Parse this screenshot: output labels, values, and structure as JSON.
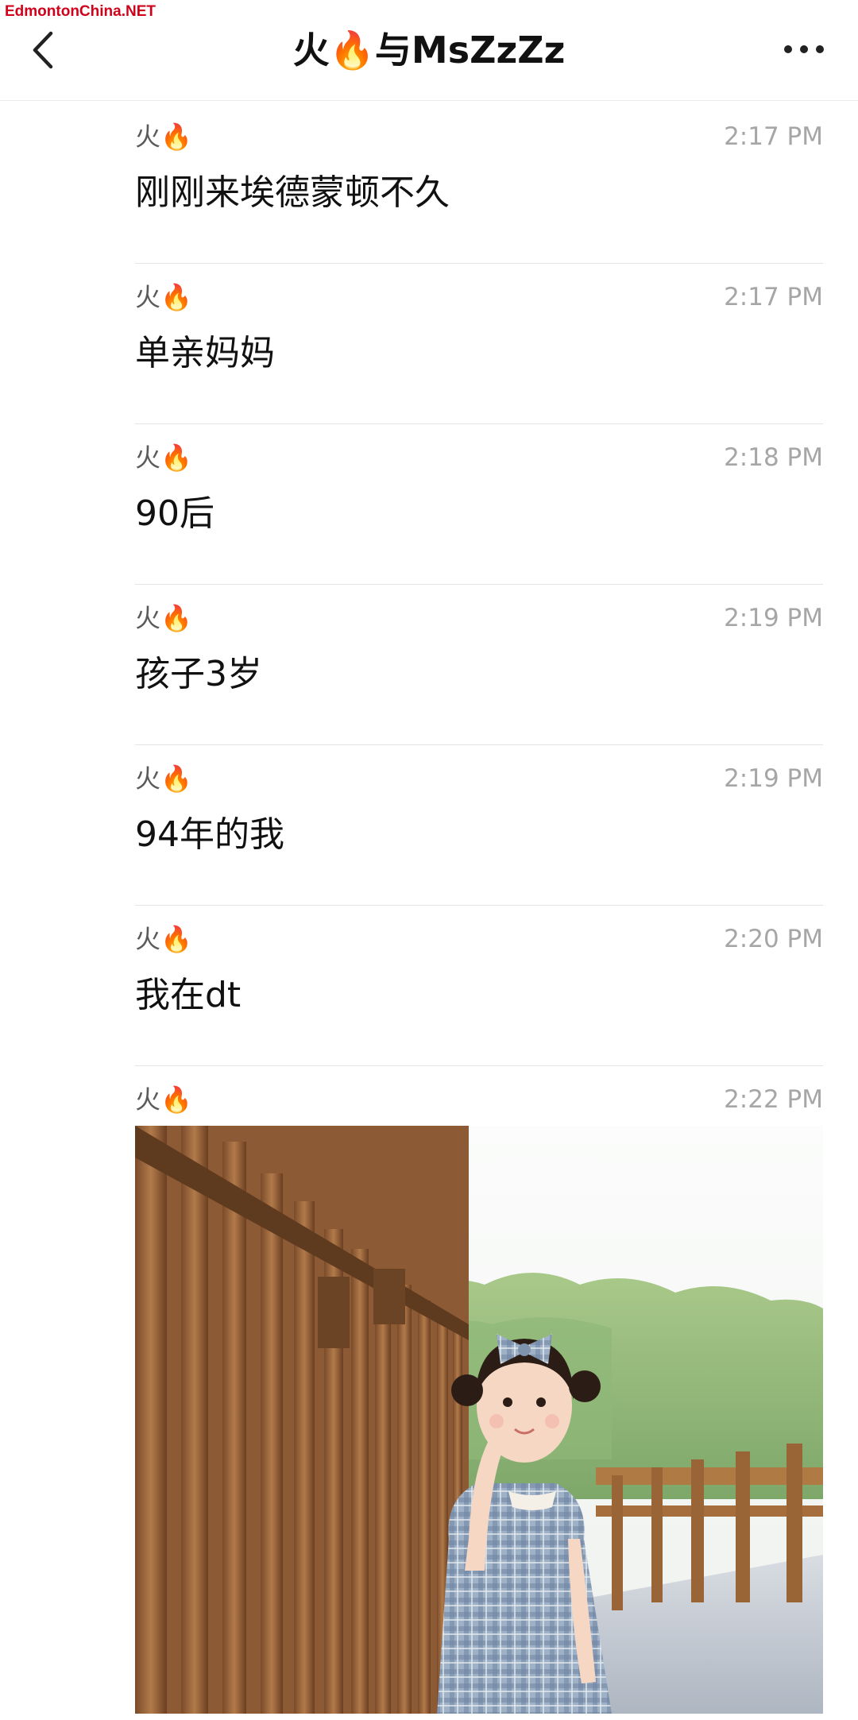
{
  "watermark": "EdmontonChina.NET",
  "header": {
    "title": "火🔥与MsZzZz",
    "back_icon": "chevron-left-icon",
    "more_icon": "more-horizontal-icon"
  },
  "messages": [
    {
      "sender": "火🔥",
      "time": "2:17 PM",
      "text": "刚刚来埃德蒙顿不久"
    },
    {
      "sender": "火🔥",
      "time": "2:17 PM",
      "text": "单亲妈妈"
    },
    {
      "sender": "火🔥",
      "time": "2:18 PM",
      "text": "90后"
    },
    {
      "sender": "火🔥",
      "time": "2:19 PM",
      "text": "孩子3岁"
    },
    {
      "sender": "火🔥",
      "time": "2:19 PM",
      "text": "94年的我"
    },
    {
      "sender": "火🔥",
      "time": "2:20 PM",
      "text": "我在dt"
    },
    {
      "sender": "火🔥",
      "time": "2:22 PM",
      "text": "",
      "image": "photo-of-child-on-wooden-bridge"
    }
  ]
}
